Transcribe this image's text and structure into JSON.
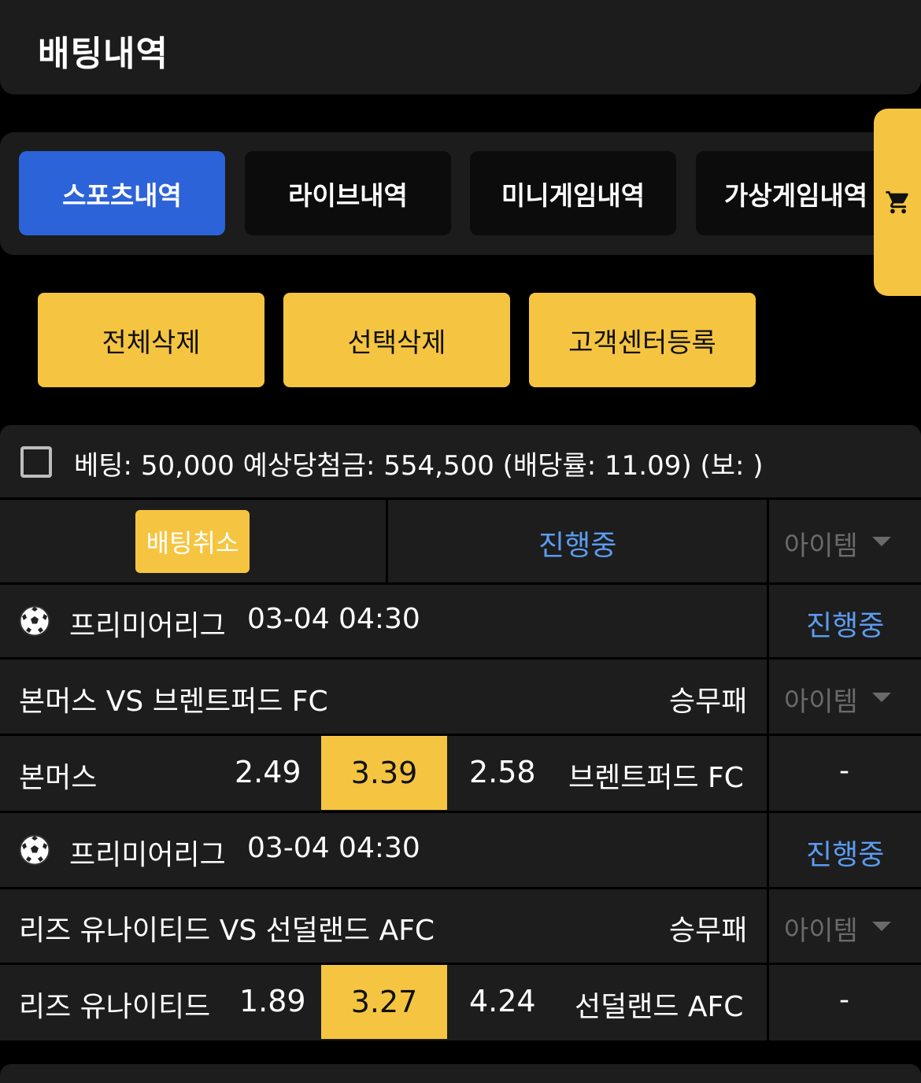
{
  "header": {
    "title": "배팅내역"
  },
  "tabs": [
    {
      "label": "스포츠내역",
      "active": true
    },
    {
      "label": "라이브내역",
      "active": false
    },
    {
      "label": "미니게임내역",
      "active": false
    },
    {
      "label": "가상게임내역",
      "active": false
    }
  ],
  "cart": {
    "icon": "cart-icon"
  },
  "actions": [
    {
      "label": "전체삭제"
    },
    {
      "label": "선택삭제"
    },
    {
      "label": "고객센터등록"
    }
  ],
  "bet": {
    "summary": "베팅: 50,000 예상당첨금: 554,500 (배당률: 11.09) (보: )",
    "cancel_label": "배팅취소",
    "status": "진행중",
    "item_label": "아이템",
    "games": [
      {
        "league": "프리미어리그",
        "time": "03-04 04:30",
        "status": "진행중",
        "match": "본머스 VS 브렌트퍼드 FC",
        "bet_type": "승무패",
        "item_label": "아이템",
        "home": "본머스",
        "home_odds": "2.49",
        "draw_odds": "3.39",
        "away_odds": "2.58",
        "away": "브렌트퍼드 FC",
        "result": "-"
      },
      {
        "league": "프리미어리그",
        "time": "03-04 04:30",
        "status": "진행중",
        "match": "리즈 유나이티드 VS 선덜랜드 AFC",
        "bet_type": "승무패",
        "item_label": "아이템",
        "home": "리즈 유나이티드",
        "home_odds": "1.89",
        "draw_odds": "3.27",
        "away_odds": "4.24",
        "away": "선덜랜드 AFC",
        "result": "-"
      }
    ]
  },
  "colors": {
    "accent_yellow": "#f5c542",
    "active_blue": "#2d63d8",
    "status_blue": "#5b9cf0"
  }
}
